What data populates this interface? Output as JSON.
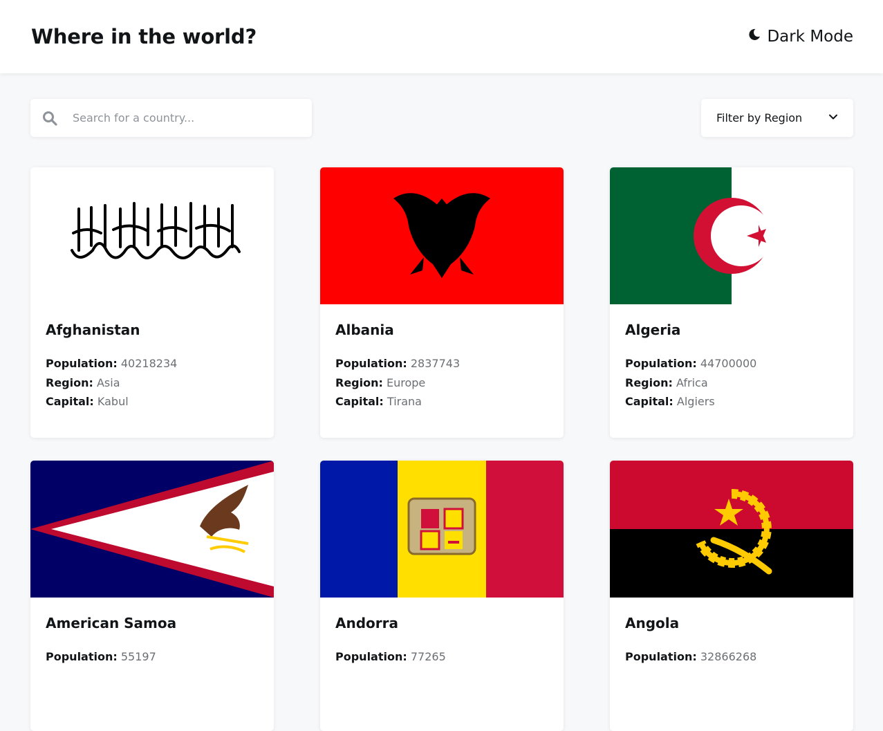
{
  "header": {
    "title": "Where in the world?",
    "mode_label": "Dark Mode"
  },
  "search": {
    "placeholder": "Search for a country..."
  },
  "filter": {
    "label": "Filter by Region"
  },
  "labels": {
    "population": "Population:",
    "region": "Region:",
    "capital": "Capital:"
  },
  "countries": [
    {
      "name": "Afghanistan",
      "population": "40218234",
      "region": "Asia",
      "capital": "Kabul"
    },
    {
      "name": "Albania",
      "population": "2837743",
      "region": "Europe",
      "capital": "Tirana"
    },
    {
      "name": "Algeria",
      "population": "44700000",
      "region": "Africa",
      "capital": "Algiers"
    },
    {
      "name": "American Samoa",
      "population": "55197",
      "region": "",
      "capital": ""
    },
    {
      "name": "Andorra",
      "population": "77265",
      "region": "",
      "capital": ""
    },
    {
      "name": "Angola",
      "population": "32866268",
      "region": "",
      "capital": ""
    }
  ]
}
